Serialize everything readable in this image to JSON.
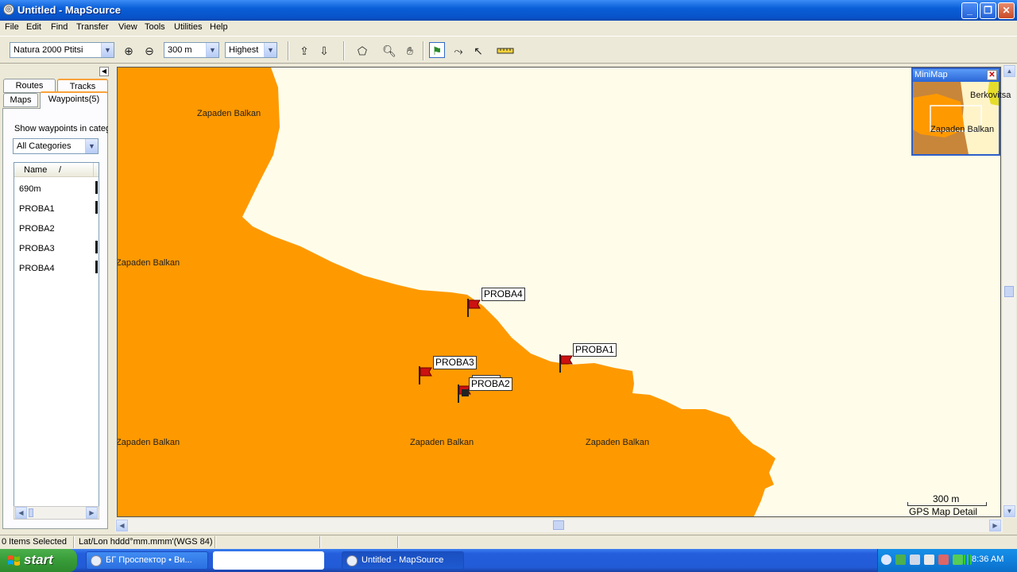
{
  "window": {
    "title": "Untitled - MapSource"
  },
  "menu": [
    "File",
    "Edit",
    "Find",
    "Transfer",
    "View",
    "Tools",
    "Utilities",
    "Help"
  ],
  "toolbar": {
    "map_product": "Natura 2000 Ptitsi",
    "zoom_scale": "300 m",
    "detail_level": "Highest"
  },
  "left_panel": {
    "tabs": {
      "routes": "Routes",
      "tracks": "Tracks",
      "maps": "Maps",
      "waypoints": "Waypoints(5)"
    },
    "show_label": "Show waypoints in categ",
    "category": "All Categories",
    "list_header": {
      "name": "Name",
      "sort": "/"
    },
    "waypoints": [
      "690m",
      "PROBA1",
      "PROBA2",
      "PROBA3",
      "PROBA4"
    ]
  },
  "map": {
    "area_labels": [
      "Zapaden Balkan",
      "Zapaden Balkan",
      "Zapaden Balkan",
      "Zapaden Balkan",
      "Zapaden Balkan"
    ],
    "waypoint_labels": {
      "proba1": "PROBA1",
      "proba2": "PROBA2",
      "proba3": "PROBA3",
      "proba4": "PROBA4"
    },
    "scale": "300 m",
    "detail_caption": "GPS Map Detail",
    "colors": {
      "land": "#ff9900",
      "background": "#fffdea",
      "flag": "#cc1111"
    }
  },
  "minimap": {
    "title": "MiniMap",
    "label_city": "Berkovitsa",
    "label_area": "Zapaden Balkan"
  },
  "statusbar": {
    "selection": "0 Items Selected",
    "coord_format": "Lat/Lon hddd°mm.mmm'(WGS 84)"
  },
  "taskbar": {
    "start": "start",
    "items": [
      "БГ Проспектор • Ви...",
      "",
      "Untitled - MapSource"
    ],
    "clock": "8:36 AM"
  }
}
